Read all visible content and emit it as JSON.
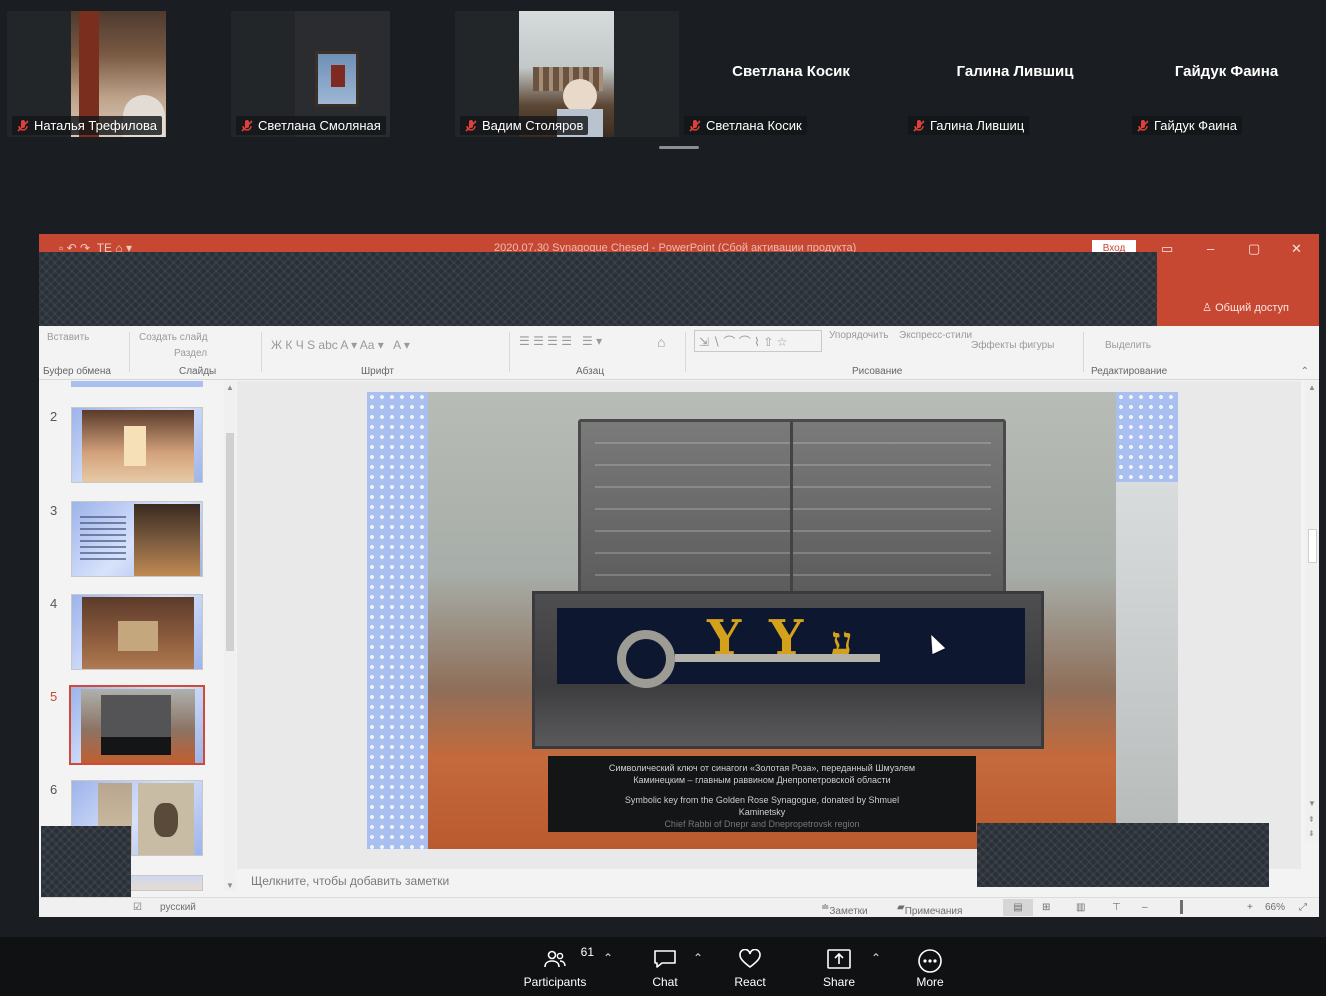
{
  "participants": [
    {
      "name": "Наталья Трефилова",
      "video": true,
      "muted": true
    },
    {
      "name": "Светлана Смоляная",
      "video": true,
      "muted": true
    },
    {
      "name": "Вадим Столяров",
      "video": true,
      "muted": true
    },
    {
      "name": "Светлана Косик",
      "video": false,
      "muted": true
    },
    {
      "name": "Галина Лившиц",
      "video": false,
      "muted": true
    },
    {
      "name": "Гайдук Фаина",
      "video": false,
      "muted": true
    }
  ],
  "ppt": {
    "window_title": "2020.07.30 Synagogue Chesed - PowerPoint (Сбой активации продукта)",
    "login": "Вход",
    "share": "Общий доступ",
    "ribbon_groups": [
      "Буфер обмена",
      "Слайды",
      "Шрифт",
      "Абзац",
      "Рисование",
      "Редактирование"
    ],
    "ribbon_commands": {
      "paste": "Вставить",
      "new_slide": "Создать слайд",
      "section": "Раздел",
      "arrange": "Упорядочить",
      "quick_styles": "Экспресс-стили",
      "shape_effects": "Эффекты фигуры",
      "select": "Выделить"
    },
    "slides": [
      {
        "num": "2"
      },
      {
        "num": "3"
      },
      {
        "num": "4"
      },
      {
        "num": "5",
        "active": true
      },
      {
        "num": "6"
      }
    ],
    "plaque": {
      "ru_line1": "Символический ключ от синагоги «Золотая Роза», переданный Шмуэлем",
      "ru_line2": "Каминецким – главным раввином Днепропетровской области",
      "en_line1": "Symbolic key from the Golden Rose Synagogue, donated by Shmuel",
      "en_line2": "Kaminetsky",
      "en_line3": "Chief Rabbi of Dnepr and Dnepropetrovsk region"
    },
    "notes_placeholder": "Щелкните, чтобы добавить заметки",
    "status": {
      "language": "русский",
      "notes": "Заметки",
      "comments": "Примечания",
      "zoom": "66%"
    }
  },
  "toolbar": {
    "participants_label": "Participants",
    "participants_count": "61",
    "chat_label": "Chat",
    "react_label": "React",
    "share_label": "Share",
    "more_label": "More"
  }
}
